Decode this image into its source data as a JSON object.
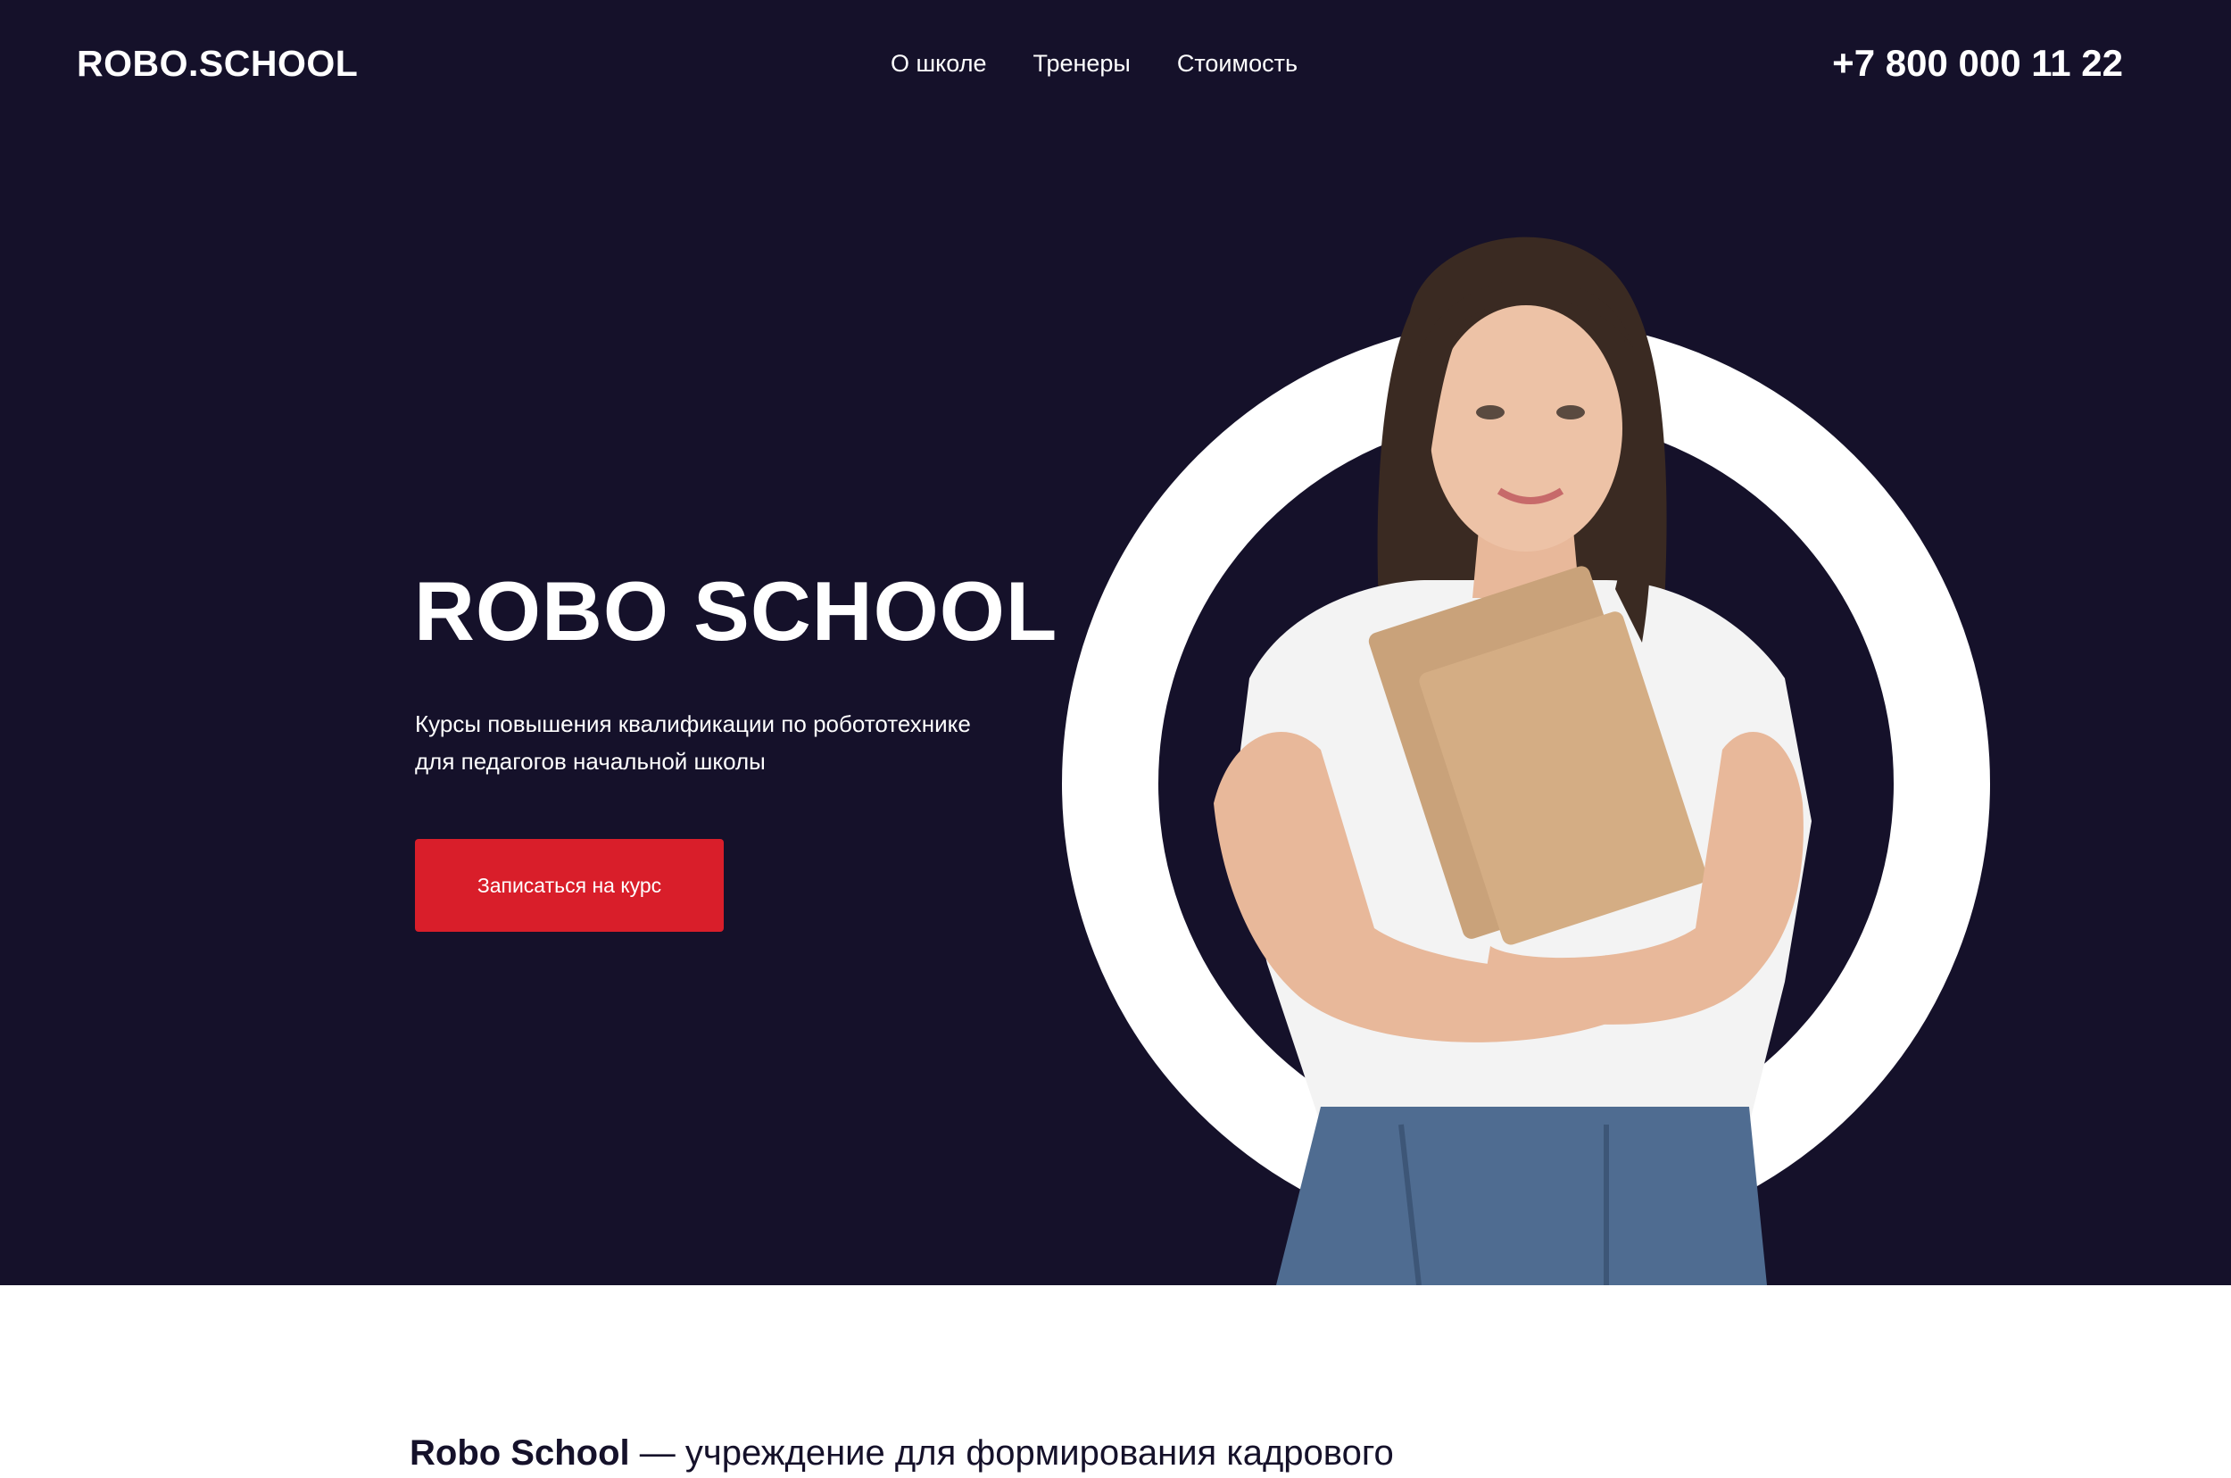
{
  "header": {
    "logo": "ROBO.SCHOOL",
    "nav": [
      "О школе",
      "Тренеры",
      "Стоимость"
    ],
    "phone": "+7 800 000 11 22"
  },
  "hero": {
    "title": "ROBO SCHOOL",
    "subtitle_line1": "Курсы повышения квалификации по робототехнике",
    "subtitle_line2": "для педагогов начальной школы",
    "cta_label": "Записаться на курс"
  },
  "about": {
    "brand": "Robo School",
    "text": " — учреждение для формирования кадрового"
  },
  "colors": {
    "hero_bg": "#15112a",
    "accent": "#d91e2a",
    "ring": "#ffffff"
  }
}
